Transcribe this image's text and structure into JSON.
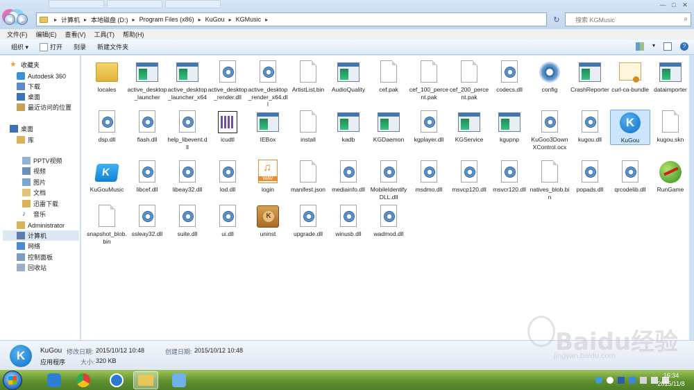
{
  "window": {
    "breadcrumbs": [
      "计算机",
      "本地磁盘 (D:)",
      "Program Files (x86)",
      "KuGou",
      "KGMusic"
    ],
    "search_placeholder": "搜索 KGMusic"
  },
  "menu": [
    "文件(F)",
    "编辑(E)",
    "查看(V)",
    "工具(T)",
    "帮助(H)"
  ],
  "toolbar": {
    "organize": "组织 ▾",
    "open": "打开",
    "burn": "刻录",
    "new_folder": "新建文件夹"
  },
  "sidebar": {
    "favorites": "收藏夹",
    "fav_items": [
      "Autodesk 360",
      "下载",
      "桌面",
      "最近访问的位置"
    ],
    "desktop": "桌面",
    "library": "库",
    "lib_items": [
      "PPTV视频",
      "视频",
      "图片",
      "文档",
      "迅雷下载",
      "音乐"
    ],
    "admin": "Administrator",
    "computer": "计算机",
    "network": "网络",
    "control_panel": "控制面板",
    "recycle_bin": "回收站"
  },
  "files": [
    {
      "name": "locales",
      "type": "folder"
    },
    {
      "name": "active_desktop_launcher",
      "type": "app"
    },
    {
      "name": "active_desktop_launcher_x64",
      "type": "app"
    },
    {
      "name": "active_desktop_render.dll",
      "type": "dll"
    },
    {
      "name": "active_desktop_render_x64.dll",
      "type": "dll"
    },
    {
      "name": "ArtistList.bin",
      "type": "doc"
    },
    {
      "name": "AudioQuality",
      "type": "app"
    },
    {
      "name": "cef.pak",
      "type": "doc"
    },
    {
      "name": "cef_100_percent.pak",
      "type": "doc"
    },
    {
      "name": "cef_200_percent.pak",
      "type": "doc"
    },
    {
      "name": "codecs.dll",
      "type": "dll"
    },
    {
      "name": "config",
      "type": "config"
    },
    {
      "name": "CrashReporter",
      "type": "app"
    },
    {
      "name": "curl-ca-bundle",
      "type": "cert"
    },
    {
      "name": "dataimporter",
      "type": "app"
    },
    {
      "name": "dsp.dll",
      "type": "dll"
    },
    {
      "name": "flash.dll",
      "type": "dll"
    },
    {
      "name": "help_libevent.dll",
      "type": "dll"
    },
    {
      "name": "icudtl",
      "type": "icudtl"
    },
    {
      "name": "IEBox",
      "type": "app"
    },
    {
      "name": "install",
      "type": "doc"
    },
    {
      "name": "kadb",
      "type": "app"
    },
    {
      "name": "KGDaemon",
      "type": "app"
    },
    {
      "name": "kgplayer.dll",
      "type": "dll"
    },
    {
      "name": "KGService",
      "type": "app"
    },
    {
      "name": "kgupnp",
      "type": "app"
    },
    {
      "name": "KuGoo3DownXControl.ocx",
      "type": "dll"
    },
    {
      "name": "kugou.dll",
      "type": "dll"
    },
    {
      "name": "KuGou",
      "type": "kugou"
    },
    {
      "name": "kugou.skn",
      "type": "doc"
    },
    {
      "name": "KuGouMusic",
      "type": "kgmusic"
    },
    {
      "name": "libcef.dll",
      "type": "dll"
    },
    {
      "name": "libeay32.dll",
      "type": "dll"
    },
    {
      "name": "lod.dll",
      "type": "dll"
    },
    {
      "name": "login",
      "type": "wav"
    },
    {
      "name": "manifest.json",
      "type": "doc"
    },
    {
      "name": "mediainfo.dll",
      "type": "dll"
    },
    {
      "name": "MobileIdentifyDLL.dll",
      "type": "dll"
    },
    {
      "name": "msdmo.dll",
      "type": "dll"
    },
    {
      "name": "msvcp120.dll",
      "type": "dll"
    },
    {
      "name": "msvcr120.dll",
      "type": "dll"
    },
    {
      "name": "natives_blob.bin",
      "type": "doc"
    },
    {
      "name": "popads.dll",
      "type": "dll"
    },
    {
      "name": "qrcodelib.dll",
      "type": "dll"
    },
    {
      "name": "RunGame",
      "type": "fruit"
    },
    {
      "name": "snapshot_blob.bin",
      "type": "doc"
    },
    {
      "name": "ssleay32.dll",
      "type": "dll"
    },
    {
      "name": "suite.dll",
      "type": "dll"
    },
    {
      "name": "ui.dll",
      "type": "dll"
    },
    {
      "name": "uninst",
      "type": "box"
    },
    {
      "name": "upgrade.dll",
      "type": "dll"
    },
    {
      "name": "winusb.dll",
      "type": "dll"
    },
    {
      "name": "wadmod.dll",
      "type": "dll"
    }
  ],
  "details": {
    "name": "KuGou",
    "type": "应用程序",
    "modified_label": "修改日期:",
    "modified_value": "2015/10/12 10:48",
    "created_label": "创建日期:",
    "created_value": "2015/10/12 10:48",
    "size_label": "大小:",
    "size_value": "320 KB"
  },
  "taskbar": {
    "time": "16:34",
    "date": "2015/11/8"
  },
  "watermark": {
    "main": "Baidu经验",
    "sub": "jingyan.baidu.com"
  }
}
